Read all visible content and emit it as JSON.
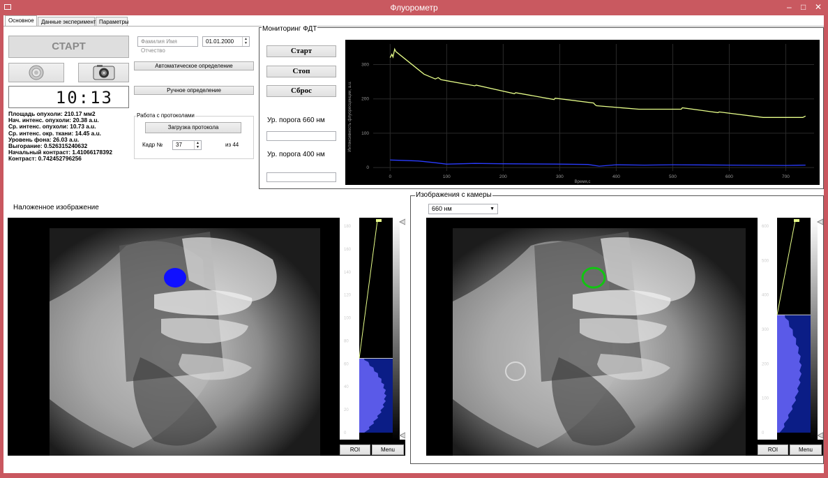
{
  "window": {
    "title": "Флуорометр",
    "minimize": "–",
    "maximize": "□",
    "close": "✕"
  },
  "tabs": [
    "Основное",
    "Данные эксперимента",
    "Параметры"
  ],
  "controls": {
    "start_label": "СТАРТ",
    "clock": "10:13",
    "name_placeholder": "Фамилия Имя Отчество",
    "date_value": "01.01.2000",
    "auto_detect_label": "Автоматическое определение",
    "manual_detect_label": "Ручное определение"
  },
  "protocols": {
    "group_title": "Работа с протоколами",
    "load_label": "Загрузка протокола",
    "frame_label": "Кадр №",
    "frame_value": "37",
    "frame_total": "из 44"
  },
  "stats": [
    "Площадь опухоли: 210.17 мм2",
    "Нач. интенс. опухоли: 20.38 a.u.",
    "Ср. интенс. опухоли: 10.73 a.u.",
    "Ср. интенс. окр. ткани: 14.45 a.u.",
    "Уровень фона: 26.03 a.u.",
    "Выгорание: 0.526315240632",
    "Начальный контраст: 1.41066178392",
    "Контраст: 0.742452796256"
  ],
  "monitoring": {
    "group_title": "Мониторинг ФДТ",
    "start_label": "Старт",
    "stop_label": "Стоп",
    "reset_label": "Сброс",
    "threshold_660_label": "Ур. порога 660 нм",
    "threshold_400_label": "Ур. порога 400 нм",
    "threshold_660_value": "",
    "threshold_400_value": ""
  },
  "chart_data": {
    "type": "line",
    "xlabel": "Время,с",
    "ylabel": "Интенсивность флуоресценции, a.u.",
    "xlim": [
      -30,
      750
    ],
    "ylim": [
      -10,
      360
    ],
    "xticks": [
      0,
      100,
      200,
      300,
      400,
      500,
      600,
      700
    ],
    "yticks": [
      0,
      100,
      200,
      300
    ],
    "grid": true,
    "background": "#000000",
    "series": [
      {
        "color": "#e8ff8a",
        "x": [
          0,
          3,
          5,
          8,
          10,
          60,
          80,
          85,
          90,
          150,
          152,
          220,
          222,
          290,
          292,
          360,
          362,
          365,
          440,
          442,
          515,
          517,
          580,
          582,
          660,
          730,
          735
        ],
        "y": [
          320,
          330,
          322,
          345,
          338,
          272,
          258,
          262,
          256,
          238,
          240,
          215,
          218,
          198,
          202,
          188,
          184,
          180,
          170,
          170,
          170,
          174,
          160,
          162,
          146,
          146,
          150
        ]
      },
      {
        "color": "#2a3cff",
        "x": [
          0,
          20,
          50,
          80,
          100,
          150,
          200,
          300,
          350,
          370,
          400,
          450,
          500,
          600,
          700,
          735
        ],
        "y": [
          22,
          21,
          19,
          14,
          10,
          12,
          11,
          10,
          9,
          4,
          8,
          7,
          8,
          7,
          6,
          7
        ]
      }
    ]
  },
  "overlay_panel": {
    "title": "Наложенное изображение",
    "hist_ticks": [
      "180",
      "160",
      "140",
      "120",
      "100",
      "80",
      "60",
      "40",
      "20",
      "0"
    ],
    "roi_label": "ROI",
    "menu_label": "Menu"
  },
  "camera_panel": {
    "title": "Изображения с камеры",
    "wavelength_selected": "660 нм",
    "hist_ticks": [
      "600",
      "500",
      "400",
      "300",
      "200",
      "100",
      "0"
    ],
    "roi_label": "ROI",
    "menu_label": "Menu"
  }
}
